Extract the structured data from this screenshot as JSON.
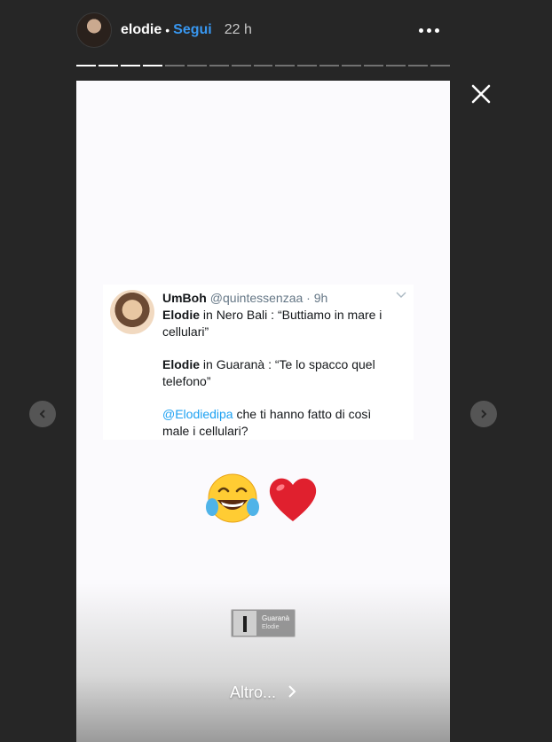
{
  "header": {
    "username": "elodie",
    "separator": "•",
    "follow_label": "Segui",
    "time_ago": "22 h"
  },
  "story_progress": {
    "total_segments": 17,
    "current_segment": 4
  },
  "tweet": {
    "name": "UmBoh",
    "handle_time": "@quintessenzaa · 9h",
    "lines": [
      {
        "bold": "Elodie",
        "text": " in Nero Bali : “Buttiamo in mare i"
      },
      {
        "bold": "",
        "text": "cellulari”"
      },
      {
        "bold": "Elodie",
        "text": " in Guaranà : “Te lo spacco quel"
      },
      {
        "bold": "",
        "text": "telefono”"
      },
      {
        "mention": "@Elodiedipa",
        "text": " che ti hanno fatto di così"
      },
      {
        "bold": "",
        "text": "male i cellulari?"
      }
    ]
  },
  "emojis": [
    "face-with-tears-of-joy-emoji",
    "red-heart-emoji"
  ],
  "music_sticker": {
    "title": "Guaranà",
    "artist": "Elodie"
  },
  "footer": {
    "more_label": "Altro..."
  },
  "icons": {
    "close": "close-icon",
    "more": "more-options-icon",
    "prev": "chevron-left-icon",
    "next": "chevron-right-icon"
  },
  "colors": {
    "background": "#262626",
    "follow": "#3897f0",
    "mention": "#1da1f2"
  }
}
